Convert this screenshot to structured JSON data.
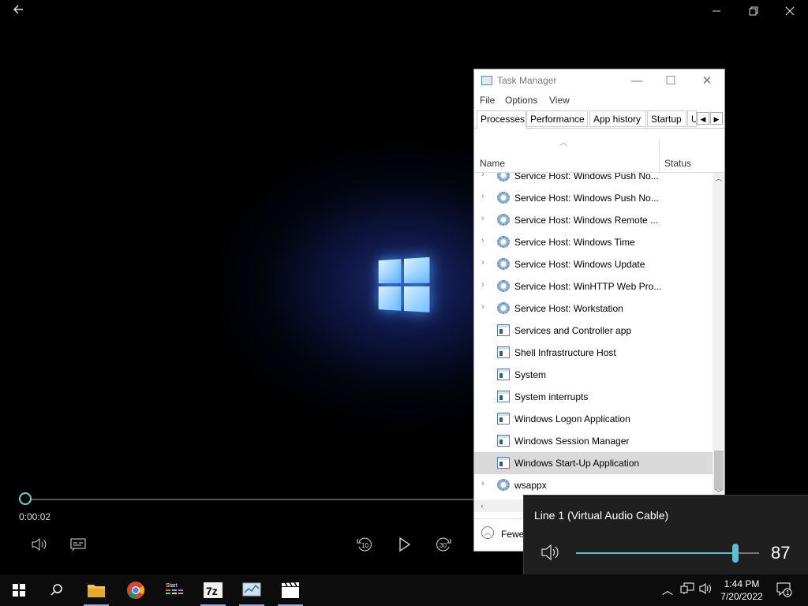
{
  "player": {
    "time": "0:00:02",
    "progress_fraction": 0.0,
    "icons": [
      "back-arrow-icon",
      "minimize-icon",
      "restore-icon",
      "close-icon",
      "volume-icon",
      "captions-icon",
      "rewind-10-icon",
      "play-icon",
      "forward-30-icon"
    ],
    "rewind_label": "10",
    "forward_label": "30"
  },
  "task_manager": {
    "title": "Task Manager",
    "menu": [
      "File",
      "Options",
      "View"
    ],
    "tabs": [
      "Processes",
      "Performance",
      "App history",
      "Startup",
      "U"
    ],
    "columns": {
      "name": "Name",
      "status": "Status"
    },
    "rows": [
      {
        "label": "Service Host: Windows Push No...",
        "icon": "gear-icon",
        "expandable": true
      },
      {
        "label": "Service Host: Windows Push No...",
        "icon": "gear-icon",
        "expandable": true
      },
      {
        "label": "Service Host: Windows Remote ...",
        "icon": "gear-icon",
        "expandable": true
      },
      {
        "label": "Service Host: Windows Time",
        "icon": "gear-icon",
        "expandable": true
      },
      {
        "label": "Service Host: Windows Update",
        "icon": "gear-icon",
        "expandable": true
      },
      {
        "label": "Service Host: WinHTTP Web Pro...",
        "icon": "gear-icon",
        "expandable": true
      },
      {
        "label": "Service Host: Workstation",
        "icon": "gear-icon",
        "expandable": true
      },
      {
        "label": "Services and Controller app",
        "icon": "window-icon",
        "expandable": false
      },
      {
        "label": "Shell Infrastructure Host",
        "icon": "window-icon",
        "expandable": false
      },
      {
        "label": "System",
        "icon": "window-icon",
        "expandable": false
      },
      {
        "label": "System interrupts",
        "icon": "window-icon",
        "expandable": false
      },
      {
        "label": "Windows Logon Application",
        "icon": "window-icon",
        "expandable": false
      },
      {
        "label": "Windows Session Manager",
        "icon": "window-icon",
        "expandable": false
      },
      {
        "label": "Windows Start-Up Application",
        "icon": "window-icon",
        "expandable": false,
        "selected": true
      },
      {
        "label": "wsappx",
        "icon": "gear-icon",
        "expandable": true
      }
    ],
    "fewer_details": "Fewe"
  },
  "volume": {
    "device": "Line 1 (Virtual Audio Cable)",
    "level": 87,
    "accent": "#5bc0d0"
  },
  "taskbar": {
    "apps": [
      "start-icon",
      "search-icon",
      "file-explorer-icon",
      "chrome-icon",
      "start-app-icon",
      "7zip-icon",
      "task-manager-icon",
      "movies-tv-icon"
    ],
    "app_7z_label": "7z",
    "app_start_label": "Start",
    "time": "1:44 PM",
    "date": "7/20/2022",
    "notification_count": "1"
  }
}
